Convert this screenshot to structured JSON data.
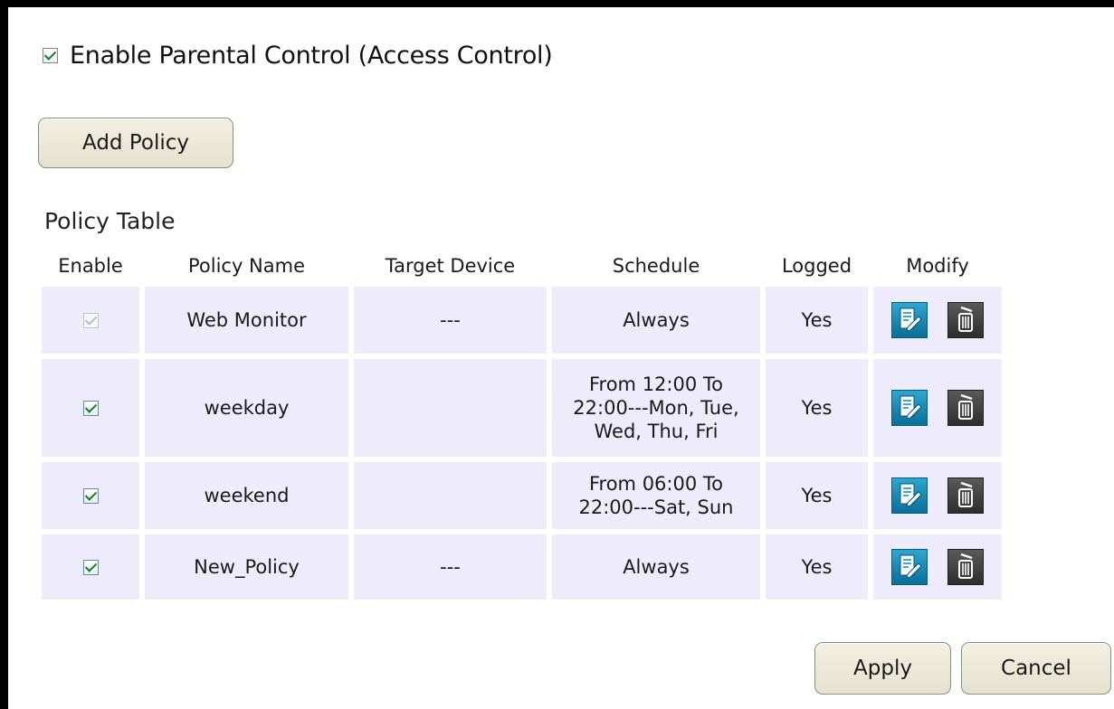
{
  "header": {
    "enable_label": "Enable Parental Control (Access Control)",
    "enable_checked": true
  },
  "buttons": {
    "add_policy": "Add Policy",
    "apply": "Apply",
    "cancel": "Cancel"
  },
  "policy_table": {
    "title": "Policy Table",
    "columns": [
      "Enable",
      "Policy Name",
      "Target Device",
      "Schedule",
      "Logged",
      "Modify"
    ],
    "rows": [
      {
        "enabled": true,
        "enable_disabled": true,
        "name": "Web Monitor",
        "target_device": "---",
        "schedule": "Always",
        "logged": "Yes"
      },
      {
        "enabled": true,
        "enable_disabled": false,
        "name": "weekday",
        "target_device": "",
        "schedule": "From 12:00 To 22:00---Mon, Tue, Wed, Thu, Fri",
        "logged": "Yes"
      },
      {
        "enabled": true,
        "enable_disabled": false,
        "name": "weekend",
        "target_device": "",
        "schedule": "From 06:00 To 22:00---Sat, Sun",
        "logged": "Yes"
      },
      {
        "enabled": true,
        "enable_disabled": false,
        "name": "New_Policy",
        "target_device": "---",
        "schedule": "Always",
        "logged": "Yes"
      }
    ],
    "icons": {
      "edit": "edit-icon",
      "delete": "trash-icon"
    }
  },
  "colors": {
    "row_background": "#eeebfa",
    "edit_icon": "#1b8fbb",
    "delete_icon": "#3a3a3a",
    "check": "#1e7a1e"
  }
}
